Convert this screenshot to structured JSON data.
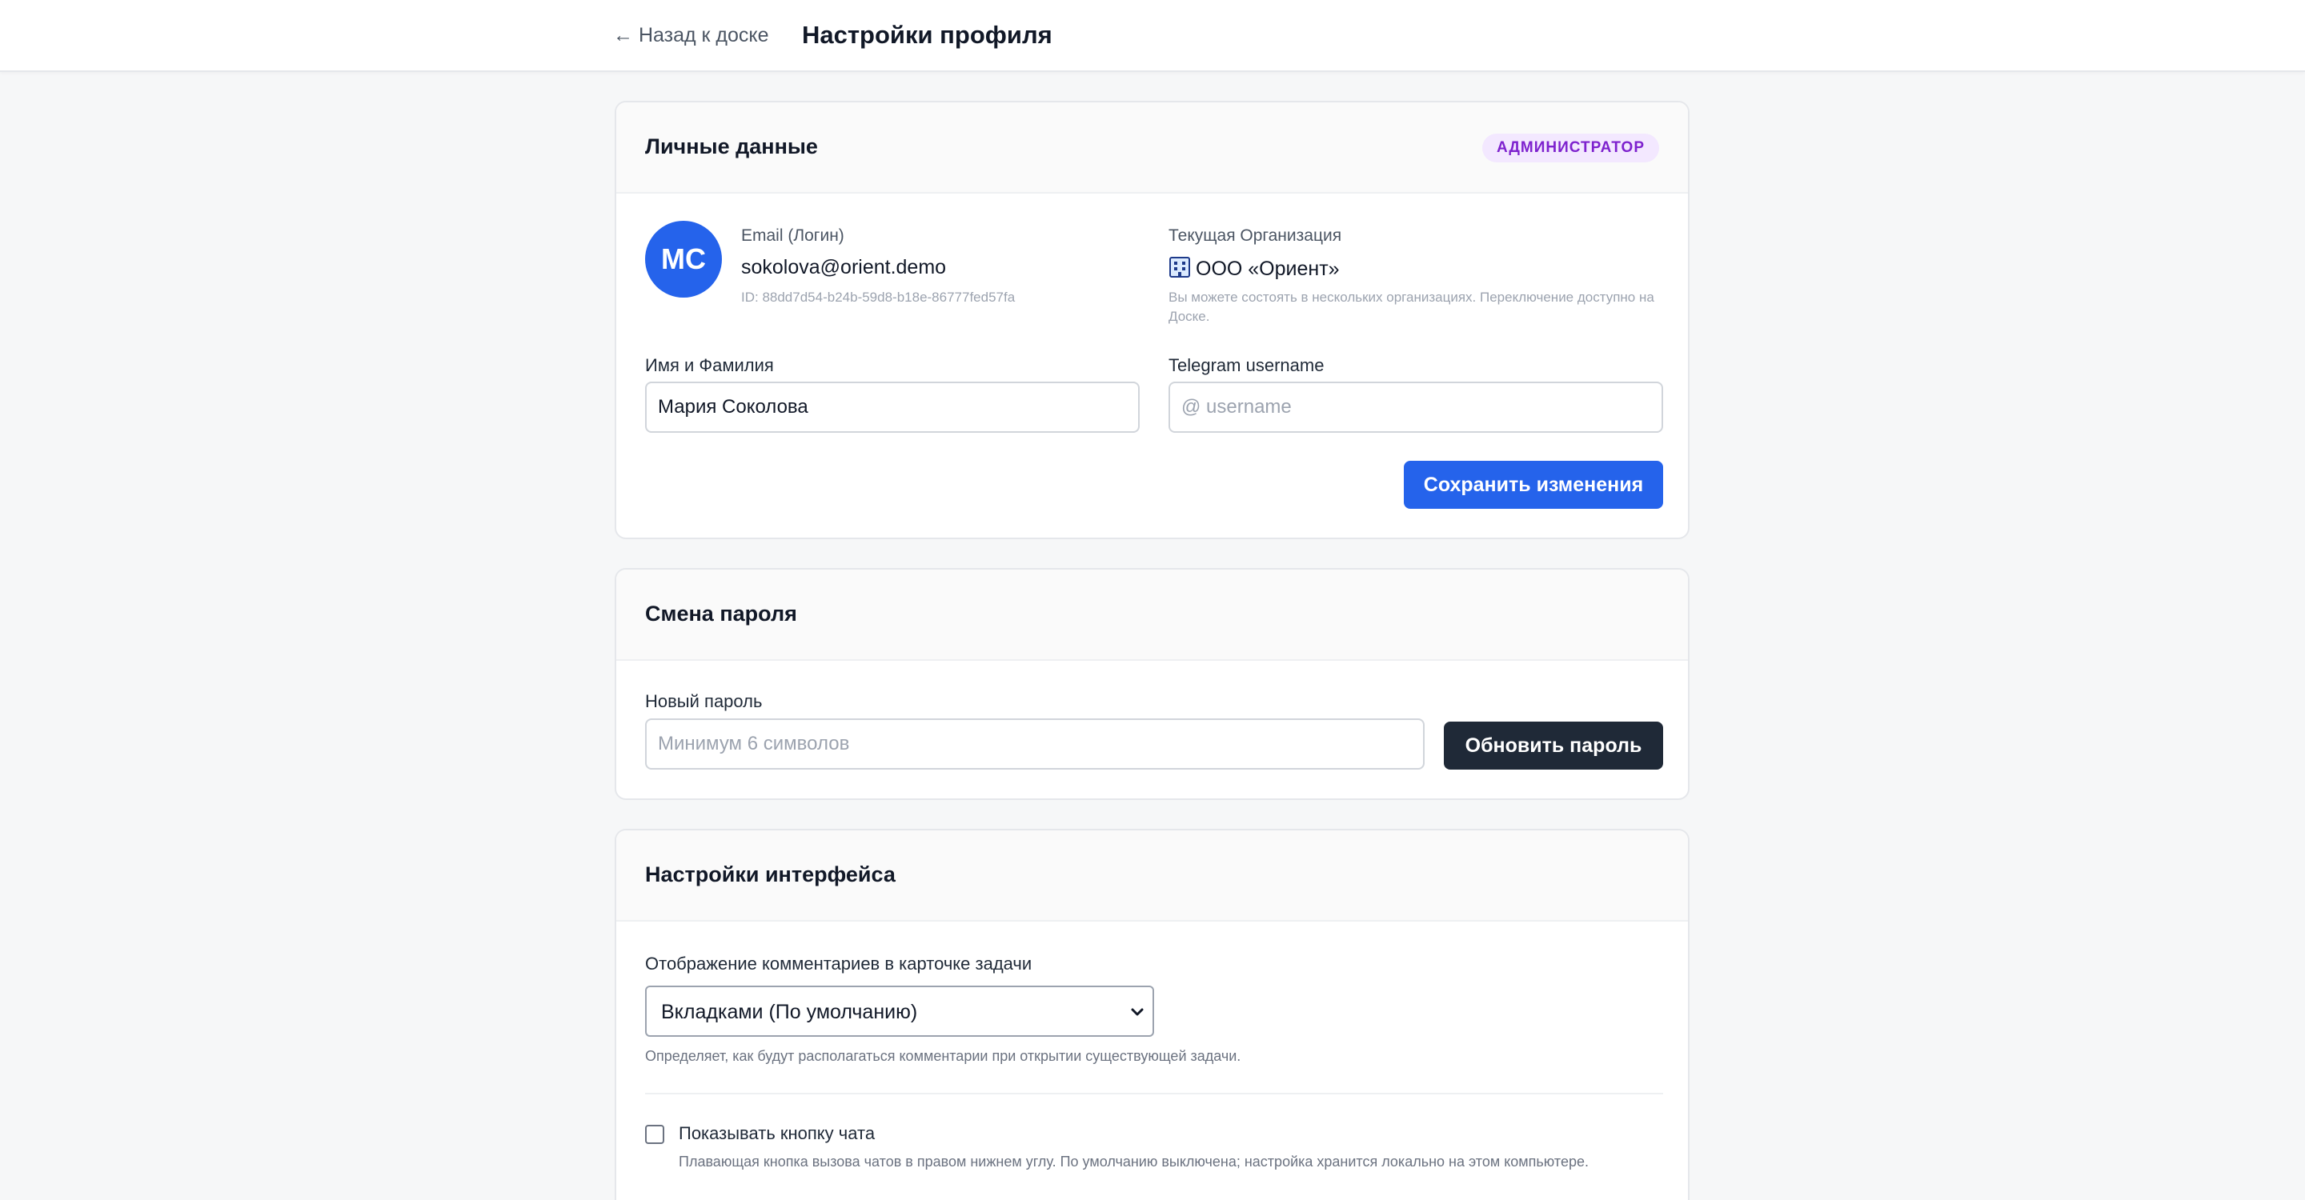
{
  "header": {
    "back_link": "← Назад к доске",
    "title": "Настройки профиля"
  },
  "personal": {
    "title": "Личные данные",
    "role_badge": "АДМИНИСТРАТОР",
    "avatar_initials": "МС",
    "email_label": "Email (Логин)",
    "email_value": "sokolova@orient.demo",
    "user_id": "ID: 88dd7d54-b24b-59d8-b18e-86777fed57fa",
    "org_label": "Текущая Организация",
    "org_icon": "building-icon",
    "org_name": "ООО «Ориент»",
    "org_hint": "Вы можете состоять в нескольких организациях. Переключение доступно на Доске.",
    "name_label": "Имя и Фамилия",
    "name_value": "Мария Соколова",
    "telegram_label": "Telegram username",
    "telegram_placeholder": "@ username",
    "telegram_value": "",
    "save_button": "Сохранить изменения"
  },
  "password": {
    "title": "Смена пароля",
    "new_label": "Новый пароль",
    "new_placeholder": "Минимум 6 символов",
    "update_button": "Обновить пароль"
  },
  "interface": {
    "title": "Настройки интерфейса",
    "comments_label": "Отображение комментариев в карточке задачи",
    "comments_selected": "Вкладками (По умолчанию)",
    "comments_hint": "Определяет, как будут располагаться комментарии при открытии существующей задачи.",
    "chat_checkbox_label": "Показывать кнопку чата",
    "chat_checkbox_checked": false,
    "chat_hint": "Плавающая кнопка вызова чатов в правом нижнем углу. По умолчанию выключена; настройка хранится локально на этом компьютере."
  },
  "colors": {
    "primary": "#2563eb",
    "dark_button": "#1f2937",
    "badge_bg": "#f3e8ff",
    "badge_text": "#7e22ce"
  }
}
